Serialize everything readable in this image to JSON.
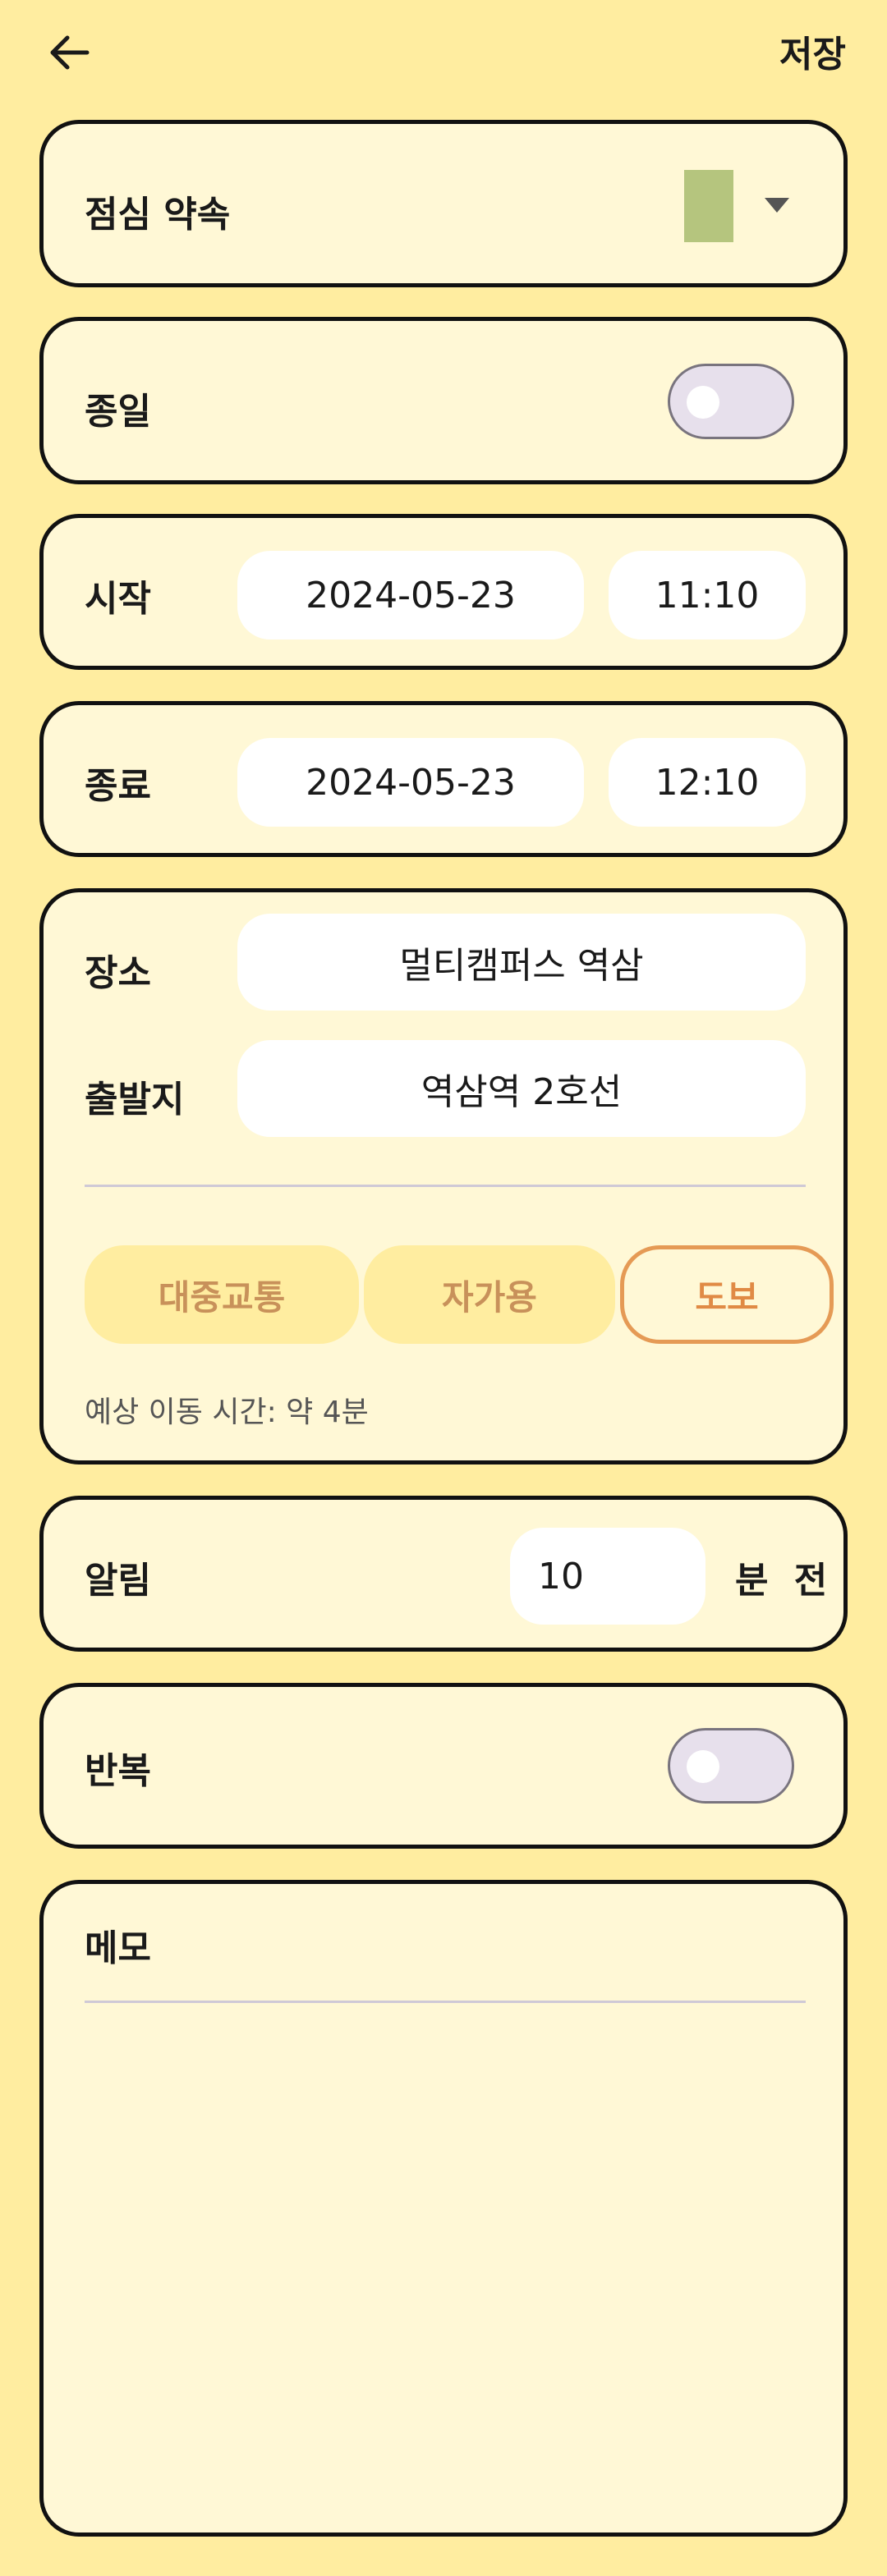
{
  "header": {
    "save_label": "저장"
  },
  "title_card": {
    "title": "점심 약속",
    "color_swatch": "#B5C57E"
  },
  "all_day": {
    "label": "종일",
    "enabled": false
  },
  "start": {
    "label": "시작",
    "date": "2024-05-23",
    "time": "11:10"
  },
  "end": {
    "label": "종료",
    "date": "2024-05-23",
    "time": "12:10"
  },
  "location": {
    "place_label": "장소",
    "place_value": "멀티캠퍼스 역삼",
    "origin_label": "출발지",
    "origin_value": "역삼역 2호선",
    "modes": [
      "대중교통",
      "자가용",
      "도보"
    ],
    "selected_mode": "도보",
    "travel_time": "예상 이동 시간: 약 4분"
  },
  "alarm": {
    "label": "알림",
    "value": "10",
    "suffix": "분 전"
  },
  "repeat": {
    "label": "반복",
    "enabled": false
  },
  "memo": {
    "label": "메모",
    "value": ""
  },
  "colors": {
    "background": "#FFEDA0",
    "card": "#FFF8D6",
    "accent_orange": "#E59A55",
    "toggle_off": "#E7E0EC"
  }
}
